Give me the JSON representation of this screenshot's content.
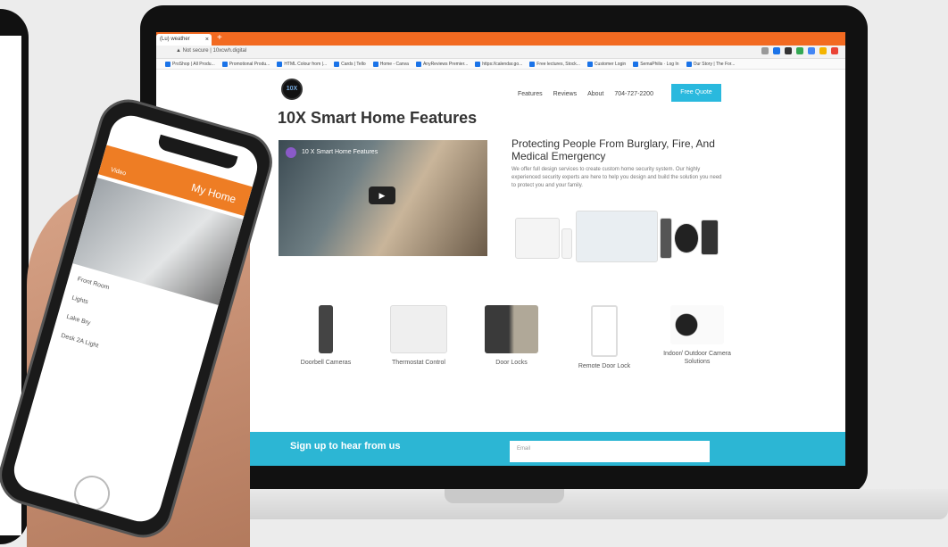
{
  "browser": {
    "tab_label": "(Lu) weather",
    "tab_close": "×",
    "new_tab": "+",
    "url": "▲ Not secure | 10xcwh.digital",
    "bookmarks": [
      "ProShop | All Produ...",
      "Promotional Produ...",
      "HTML Colour from |...",
      "Cards | Tello",
      "Home - Canva",
      "AnyReviews Premier...",
      "https://calendar.go...",
      "Free lectures, Stock...",
      "Customer Login",
      "SemaPhilis · Log In",
      "Our Story | The For..."
    ]
  },
  "site": {
    "logo": "10X",
    "nav": [
      "Features",
      "Reviews",
      "About",
      "704-727-2200"
    ],
    "quote_button": "Free Quote",
    "title": "10X Smart Home Features",
    "video_title": "10 X Smart Home Features",
    "play_icon": "▶",
    "hero_heading": "Protecting People From Burglary, Fire, And Medical Emergency",
    "hero_text": "We offer full design services to create custom home security system. Our highly experienced security experts are here to help you design and build the solution you need to protect you and your family.",
    "features": [
      "Doorbell Cameras",
      "Thermostat Control",
      "Door Locks",
      "Remote Door Lock",
      "Indoor/ Outdoor Camera Solutions"
    ],
    "signup": "Sign up to hear from us",
    "email_placeholder": "Email"
  },
  "app": {
    "title": "My Home",
    "video_label": "Video",
    "rows": [
      "Front Room",
      "Lights",
      "Lake Bry",
      "Desk 2A Light"
    ]
  },
  "colors": {
    "accent_orange": "#f26a21",
    "accent_cyan": "#2cb6d4"
  }
}
